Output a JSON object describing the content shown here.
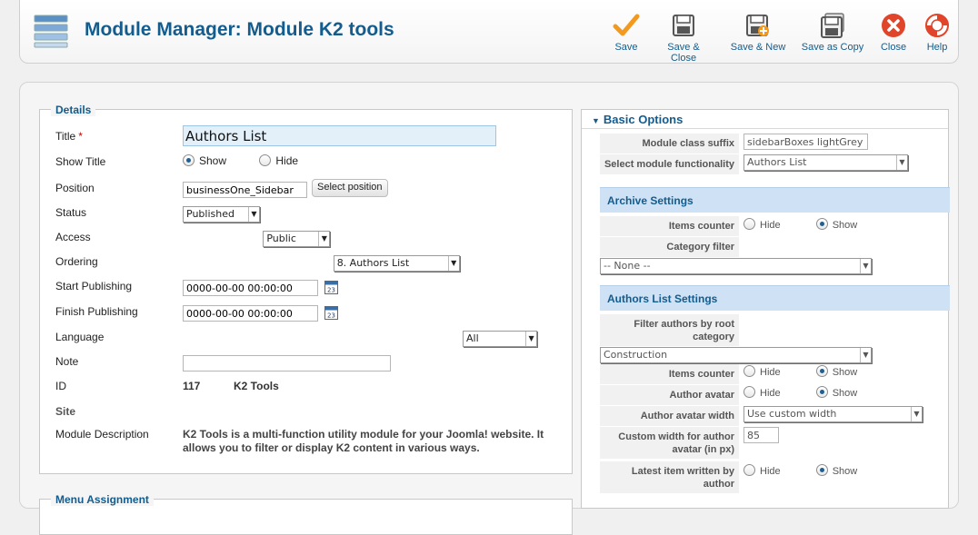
{
  "header": {
    "title": "Module Manager: Module K2 tools"
  },
  "toolbar": {
    "save": "Save",
    "save_close": "Save & Close",
    "save_new": "Save & New",
    "save_copy": "Save as Copy",
    "close": "Close",
    "help": "Help"
  },
  "details": {
    "legend": "Details",
    "title_label": "Title",
    "title_value": "Authors List",
    "show_title_label": "Show Title",
    "show_option": "Show",
    "hide_option": "Hide",
    "position_label": "Position",
    "position_value": "businessOne_Sidebar",
    "select_position": "Select position",
    "status_label": "Status",
    "status_value": "Published",
    "access_label": "Access",
    "access_value": "Public",
    "ordering_label": "Ordering",
    "ordering_value": "8. Authors List",
    "start_label": "Start Publishing",
    "start_value": "0000-00-00 00:00:00",
    "finish_label": "Finish Publishing",
    "finish_value": "0000-00-00 00:00:00",
    "calendar_day": "23",
    "language_label": "Language",
    "language_value": "All",
    "note_label": "Note",
    "note_value": "",
    "id_label": "ID",
    "id_value": "117",
    "id_module": "K2 Tools",
    "site_label": "Site",
    "desc_label": "Module Description",
    "desc_value": "K2 Tools is a multi-function utility module for your Joomla! website. It allows you to filter or display K2 content in various ways."
  },
  "menu_assignment": {
    "legend": "Menu Assignment"
  },
  "basic": {
    "heading": "Basic Options",
    "suffix_label": "Module class suffix",
    "suffix_value": "sidebarBoxes lightGrey",
    "func_label": "Select module functionality",
    "func_value": "Authors List",
    "archive_heading": "Archive Settings",
    "items_counter_label": "Items counter",
    "hide": "Hide",
    "show": "Show",
    "category_filter_label": "Category filter",
    "category_filter_value": "-- None --",
    "authors_heading": "Authors List Settings",
    "filter_root_label": "Filter authors by root category",
    "filter_root_value": "Construction",
    "items_counter2_label": "Items counter",
    "avatar_label": "Author avatar",
    "avatar_width_label": "Author avatar width",
    "avatar_width_value": "Use custom width",
    "custom_width_label": "Custom width for author avatar (in px)",
    "custom_width_value": "85",
    "latest_label": "Latest item written by author"
  },
  "colors": {
    "accent": "#135c8d",
    "section_bg": "#cfe2f5",
    "close_red": "#e0442a",
    "save_check": "#f39a1e"
  }
}
